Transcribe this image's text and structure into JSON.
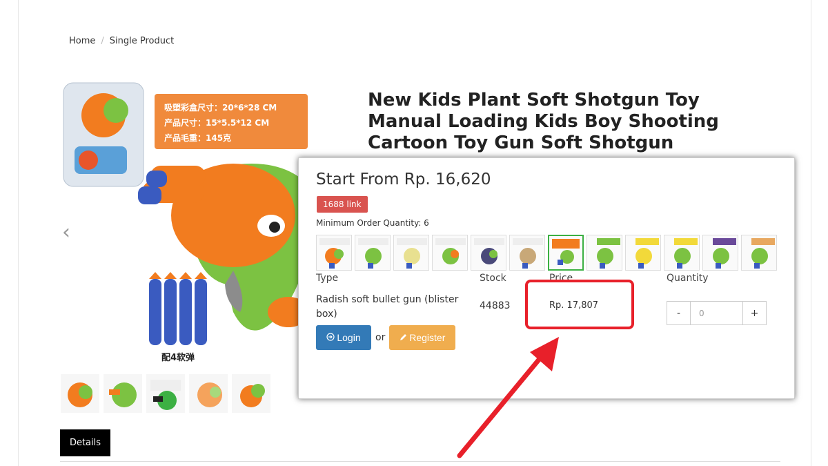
{
  "breadcrumb": {
    "home": "Home",
    "separator": "/",
    "current": "Single Product"
  },
  "product": {
    "title": "New Kids Plant Soft Shotgun Toy Manual Loading Kids Boy Shooting Cartoon Toy Gun Soft Shotgun",
    "image_text": {
      "line1": "吸塑彩盒尺寸：20*6*28 CM",
      "line2": "产品尺寸：15*5.5*12 CM",
      "line3": "产品毛重：145克",
      "caption": "配4软弹"
    }
  },
  "popup": {
    "start_price": "Start From Rp. 16,620",
    "badge": "1688 link",
    "moq": "Minimum Order Quantity: 6",
    "columns": {
      "type": "Type",
      "stock": "Stock",
      "price": "Price",
      "quantity": "Quantity"
    },
    "row": {
      "type": "Radish soft bullet gun (blister box)",
      "stock": "44883",
      "price": "Rp. 17,807"
    },
    "quantity": {
      "value": "0",
      "minus": "-",
      "plus": "+"
    },
    "login": "Login",
    "or": "or",
    "register": "Register"
  },
  "tabs": {
    "details": "Details"
  },
  "icons": {
    "prev": "chevron-left-icon",
    "login": "sign-in-icon",
    "register": "pencil-icon"
  },
  "colors": {
    "badge": "#d9534f",
    "login": "#337ab7",
    "register": "#f0ad4e",
    "selected_variant": "#3cb043",
    "annotation": "#e8202a"
  }
}
